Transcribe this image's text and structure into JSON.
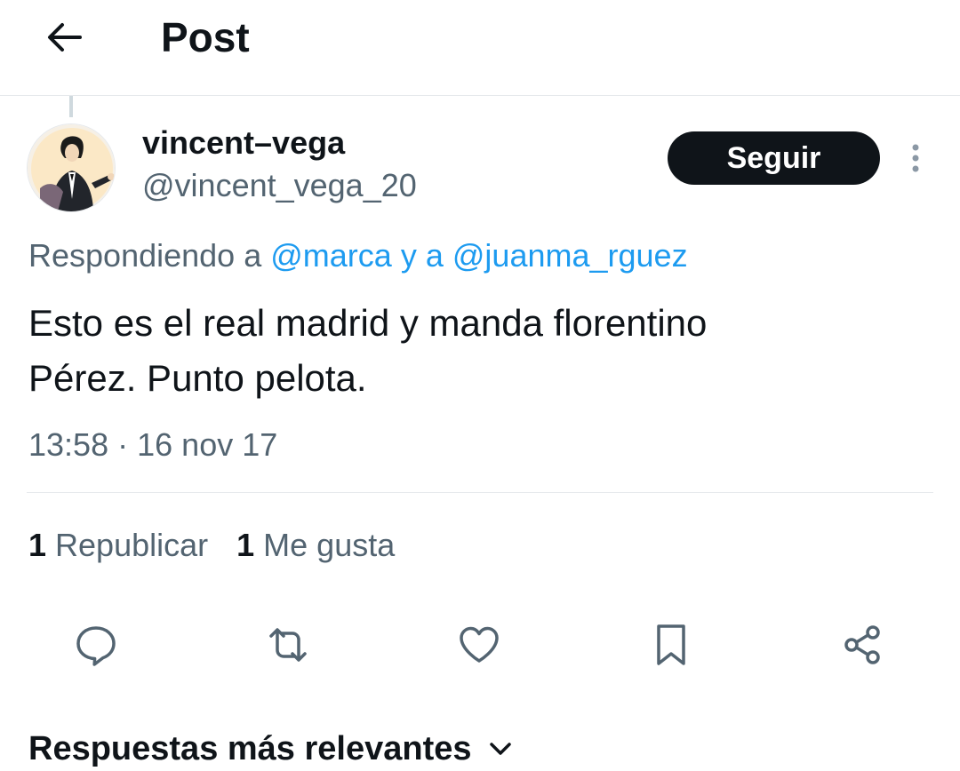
{
  "header": {
    "title": "Post",
    "back_icon": "arrow-left-icon"
  },
  "tweet": {
    "author": {
      "display_name": "vincent–vega",
      "handle": "@vincent_vega_20",
      "avatar_icon": "user-avatar"
    },
    "follow_label": "Seguir",
    "more_icon": "more-vertical-icon",
    "replying_to": {
      "prefix": "Respondiendo a",
      "user1": "@marca",
      "connector": "y a",
      "user2": "@juanma_rguez"
    },
    "text_line1": "Esto es el real madrid y manda florentino",
    "text_line2": "Pérez. Punto pelota.",
    "time": "13:58",
    "separator": "·",
    "date": "16 nov 17"
  },
  "stats": {
    "reposts_count": "1",
    "reposts_label": "Republicar",
    "likes_count": "1",
    "likes_label": "Me gusta"
  },
  "actions": [
    {
      "icon": "reply-icon"
    },
    {
      "icon": "repost-icon"
    },
    {
      "icon": "heart-icon"
    },
    {
      "icon": "bookmark-icon"
    },
    {
      "icon": "share-icon"
    }
  ],
  "replies_section": {
    "title": "Respuestas más relevantes",
    "icon": "chevron-down-icon"
  },
  "colors": {
    "link": "#1d9bf0",
    "secondary_text": "#536471",
    "primary_text": "#0f1419",
    "button_bg": "#0f1419",
    "divider": "#e6e9ec"
  }
}
